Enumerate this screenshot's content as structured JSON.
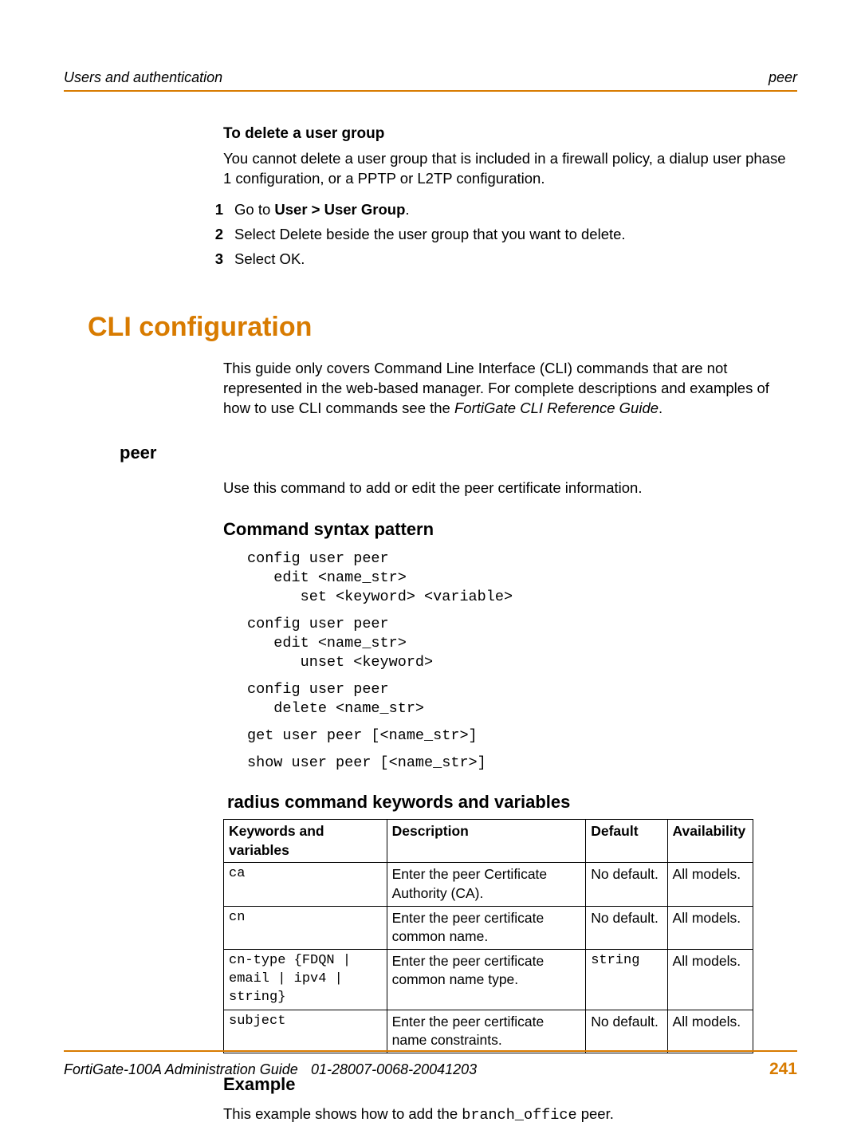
{
  "header": {
    "left": "Users and authentication",
    "right": "peer"
  },
  "section_delete": {
    "title": "To delete a user group",
    "para": "You cannot delete a user group that is included in a firewall policy, a dialup user phase 1 configuration, or a PPTP or L2TP configuration.",
    "step1_prefix": "Go to ",
    "step1_bold": "User > User Group",
    "step1_suffix": ".",
    "step2": "Select Delete beside the user group that you want to delete.",
    "step3": "Select OK."
  },
  "cli_heading": "CLI configuration",
  "cli_intro_a": "This guide only covers Command Line Interface (CLI) commands that are not represented in the web-based manager. For complete descriptions and examples of how to use CLI commands see the ",
  "cli_intro_italic": "FortiGate CLI Reference Guide",
  "cli_intro_b": ".",
  "peer_heading": "peer",
  "peer_para": "Use this command to add or edit the peer certificate information.",
  "syntax_heading": "Command syntax pattern",
  "syntax_block1": "config user peer\n   edit <name_str>\n      set <keyword> <variable>",
  "syntax_block2": "config user peer\n   edit <name_str>\n      unset <keyword>",
  "syntax_block3": "config user peer\n   delete <name_str>",
  "syntax_block4": "get user peer [<name_str>]",
  "syntax_block5": "show user peer [<name_str>]",
  "table_heading": "radius command keywords and variables",
  "table_cols": {
    "kw": "Keywords and variables",
    "desc": "Description",
    "def": "Default",
    "avail": "Availability"
  },
  "table_rows": [
    {
      "kw": "ca",
      "desc": "Enter the peer Certificate Authority (CA).",
      "def": "No default.",
      "avail": "All models."
    },
    {
      "kw": "cn",
      "desc": "Enter the peer certificate common name.",
      "def": "No default.",
      "avail": "All models."
    },
    {
      "kw": "cn-type {FDQN | email | ipv4 | string}",
      "desc": "Enter the peer certificate common name type.",
      "def_code": "string",
      "avail": "All models."
    },
    {
      "kw": "subject",
      "desc": "Enter the peer certificate name constraints.",
      "def": "No default.",
      "avail": "All models."
    }
  ],
  "example_heading": "Example",
  "example_para_a": "This example shows how to add the ",
  "example_code": "branch_office",
  "example_para_b": " peer.",
  "footer": {
    "left": "FortiGate-100A Administration Guide",
    "mid": "01-28007-0068-20041203",
    "page": "241"
  }
}
